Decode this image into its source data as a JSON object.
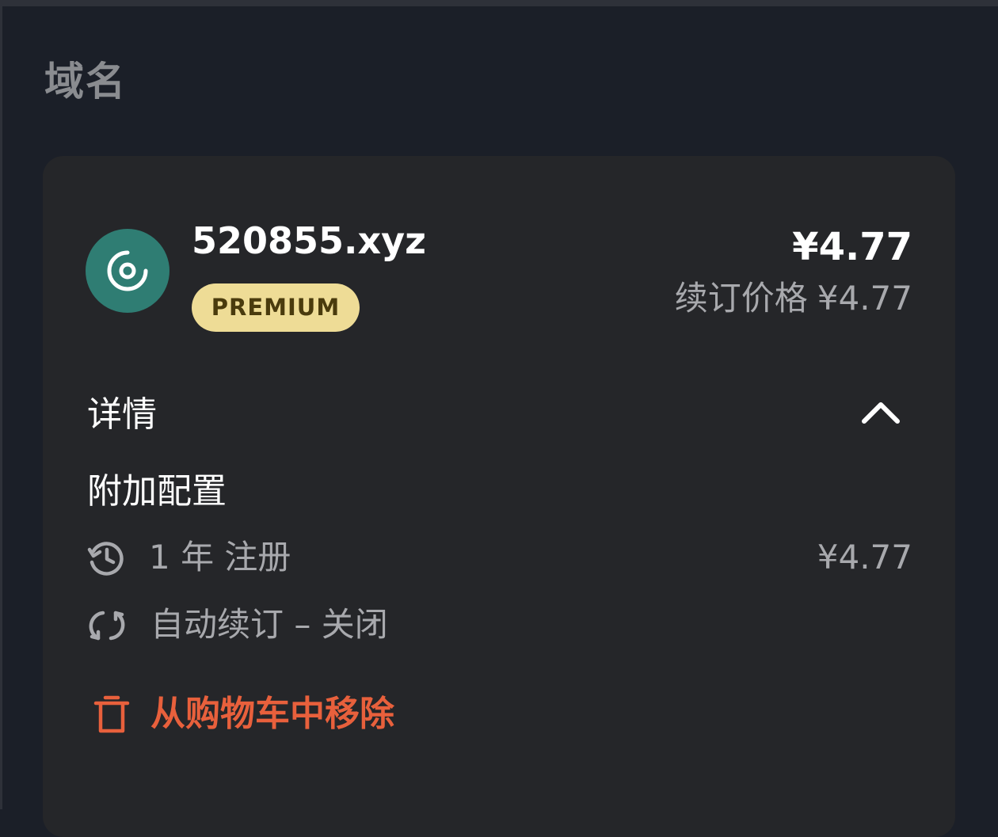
{
  "section": {
    "title": "域名"
  },
  "cart_item": {
    "domain": "520855.xyz",
    "badge": "PREMIUM",
    "price": "¥4.77",
    "renewal_label": "续订价格",
    "renewal_price": "¥4.77",
    "details_label": "详情",
    "addons_label": "附加配置",
    "registration": {
      "label": "1 年 注册",
      "price": "¥4.77"
    },
    "auto_renew": {
      "label": "自动续订 – 关闭"
    },
    "remove_label": "从购物车中移除"
  },
  "colors": {
    "page_background": "#1b1f28",
    "card_background": "#252629",
    "avatar": "#2f7d73",
    "badge_background": "#eedc96",
    "badge_text": "#4a3b0d",
    "remove": "#e8603c",
    "muted_text": "#a8a9ad"
  },
  "icons": {
    "avatar": "target-icon",
    "details_toggle": "chevron-up-icon",
    "registration": "history-icon",
    "auto_renew": "refresh-icon",
    "remove": "trash-icon"
  }
}
